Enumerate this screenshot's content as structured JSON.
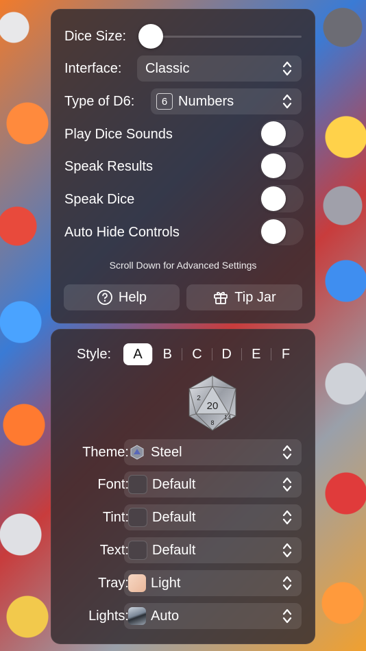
{
  "settings": {
    "dice_size_label": "Dice Size:",
    "interface_label": "Interface:",
    "interface_value": "Classic",
    "d6_label": "Type of D6:",
    "d6_icon": "6",
    "d6_value": "Numbers",
    "play_sounds_label": "Play Dice Sounds",
    "speak_results_label": "Speak Results",
    "speak_dice_label": "Speak Dice",
    "auto_hide_label": "Auto Hide Controls",
    "hint": "Scroll Down for Advanced Settings",
    "help_label": "Help",
    "tip_jar_label": "Tip Jar"
  },
  "appearance": {
    "style_label": "Style:",
    "styles": [
      "A",
      "B",
      "C",
      "D",
      "E",
      "F"
    ],
    "selected_style": "A",
    "die_face_number": "20",
    "die_side_numbers": [
      "2",
      "14",
      "8"
    ],
    "theme_label": "Theme:",
    "theme_value": "Steel",
    "font_label": "Font:",
    "font_value": "Default",
    "tint_label": "Tint:",
    "tint_value": "Default",
    "text_label": "Text:",
    "text_value": "Default",
    "tray_label": "Tray:",
    "tray_value": "Light",
    "lights_label": "Lights:",
    "lights_value": "Auto"
  },
  "colors": {
    "panel": "#342c30",
    "tray_swatch": "#f2c9b0",
    "default_swatch": "#4a4247"
  }
}
